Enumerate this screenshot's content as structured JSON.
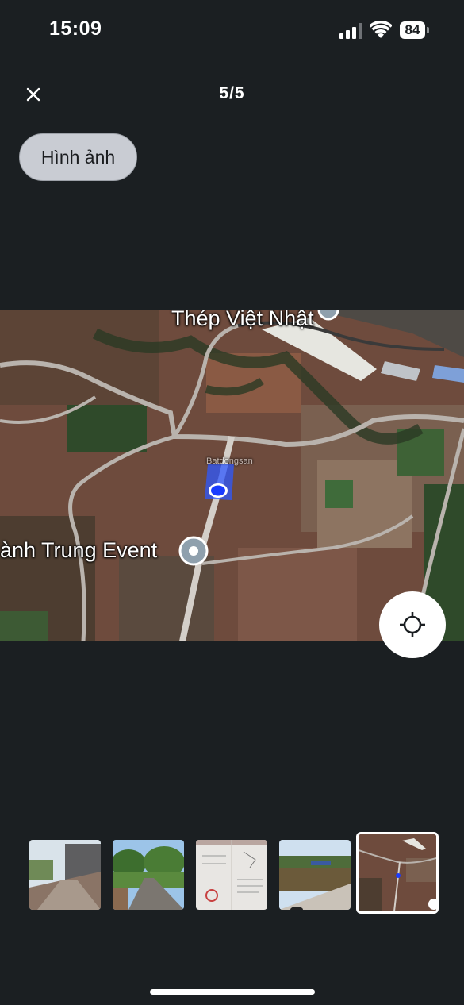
{
  "status_bar": {
    "time": "15:09",
    "battery_level": "84"
  },
  "header": {
    "close_icon": "close-icon",
    "page_counter": "5/5"
  },
  "category": {
    "label": "Hình ảnh"
  },
  "map": {
    "labels": {
      "place_top": "Thép Việt Nhật",
      "place_left": "ành Trung Event",
      "watermark": "Batdongsan"
    },
    "locate_icon": "crosshair-icon"
  },
  "thumbnails": [
    {
      "name": "road-with-house-photo",
      "active": false
    },
    {
      "name": "tree-lined-road-photo",
      "active": false
    },
    {
      "name": "land-document-photo",
      "active": false
    },
    {
      "name": "field-roadside-photo",
      "active": false
    },
    {
      "name": "satellite-map-photo",
      "active": true
    }
  ],
  "colors": {
    "background": "#1b1f22",
    "chip_background": "#c9ccd3",
    "location_dot": "#1a3cff"
  }
}
